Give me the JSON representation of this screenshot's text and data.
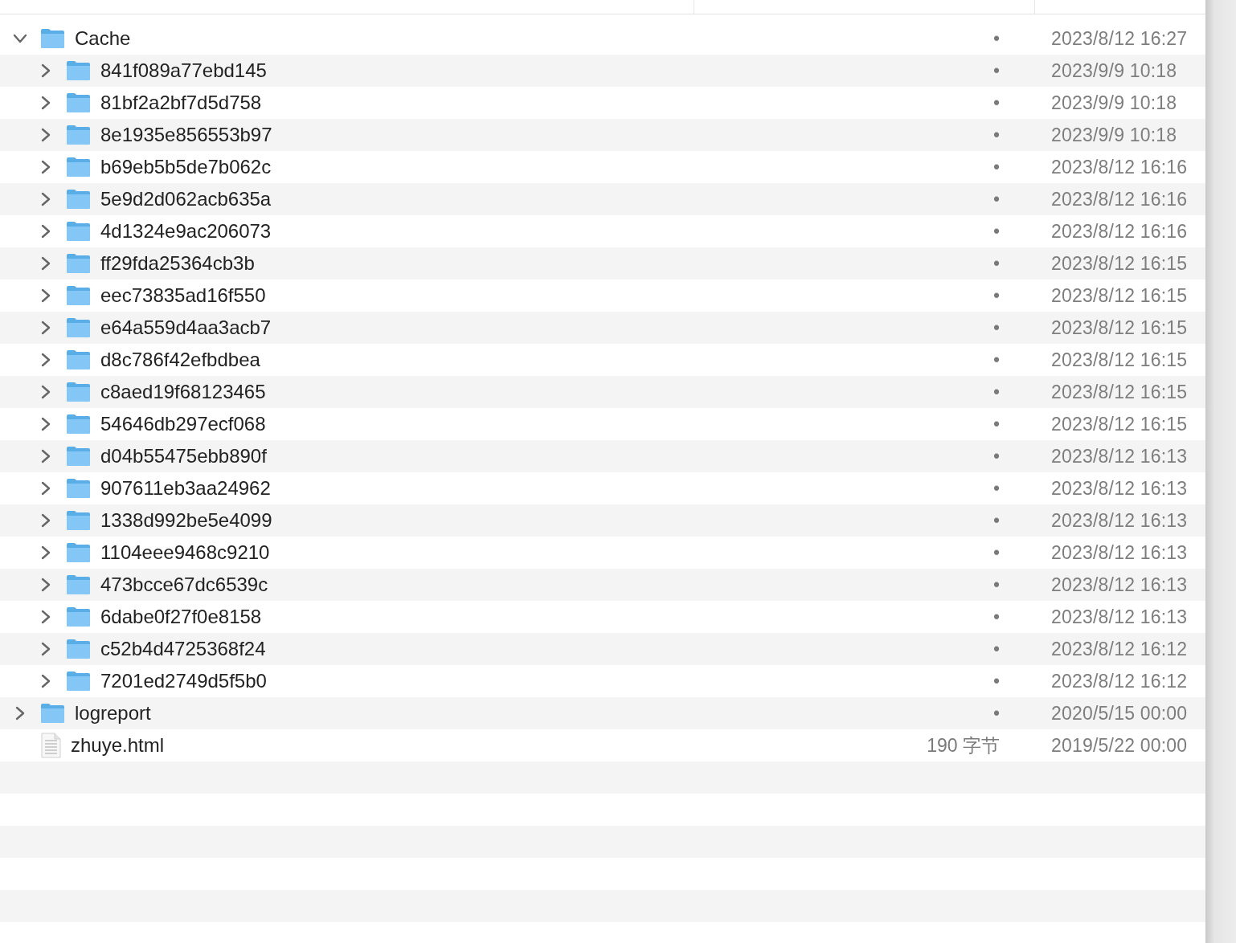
{
  "items": [
    {
      "kind": "folder",
      "name": "Cache",
      "size": "•",
      "date": "2023/8/12 16:27",
      "expanded": true,
      "children": [
        {
          "kind": "folder",
          "name": "841f089a77ebd145",
          "size": "•",
          "date": "2023/9/9 10:18",
          "expanded": false
        },
        {
          "kind": "folder",
          "name": "81bf2a2bf7d5d758",
          "size": "•",
          "date": "2023/9/9 10:18",
          "expanded": false
        },
        {
          "kind": "folder",
          "name": "8e1935e856553b97",
          "size": "•",
          "date": "2023/9/9 10:18",
          "expanded": false
        },
        {
          "kind": "folder",
          "name": "b69eb5b5de7b062c",
          "size": "•",
          "date": "2023/8/12 16:16",
          "expanded": false
        },
        {
          "kind": "folder",
          "name": "5e9d2d062acb635a",
          "size": "•",
          "date": "2023/8/12 16:16",
          "expanded": false
        },
        {
          "kind": "folder",
          "name": "4d1324e9ac206073",
          "size": "•",
          "date": "2023/8/12 16:16",
          "expanded": false
        },
        {
          "kind": "folder",
          "name": "ff29fda25364cb3b",
          "size": "•",
          "date": "2023/8/12 16:15",
          "expanded": false
        },
        {
          "kind": "folder",
          "name": "eec73835ad16f550",
          "size": "•",
          "date": "2023/8/12 16:15",
          "expanded": false
        },
        {
          "kind": "folder",
          "name": "e64a559d4aa3acb7",
          "size": "•",
          "date": "2023/8/12 16:15",
          "expanded": false
        },
        {
          "kind": "folder",
          "name": "d8c786f42efbdbea",
          "size": "•",
          "date": "2023/8/12 16:15",
          "expanded": false
        },
        {
          "kind": "folder",
          "name": "c8aed19f68123465",
          "size": "•",
          "date": "2023/8/12 16:15",
          "expanded": false
        },
        {
          "kind": "folder",
          "name": "54646db297ecf068",
          "size": "•",
          "date": "2023/8/12 16:15",
          "expanded": false
        },
        {
          "kind": "folder",
          "name": "d04b55475ebb890f",
          "size": "•",
          "date": "2023/8/12 16:13",
          "expanded": false
        },
        {
          "kind": "folder",
          "name": "907611eb3aa24962",
          "size": "•",
          "date": "2023/8/12 16:13",
          "expanded": false
        },
        {
          "kind": "folder",
          "name": "1338d992be5e4099",
          "size": "•",
          "date": "2023/8/12 16:13",
          "expanded": false
        },
        {
          "kind": "folder",
          "name": "1104eee9468c9210",
          "size": "•",
          "date": "2023/8/12 16:13",
          "expanded": false
        },
        {
          "kind": "folder",
          "name": "473bcce67dc6539c",
          "size": "•",
          "date": "2023/8/12 16:13",
          "expanded": false
        },
        {
          "kind": "folder",
          "name": "6dabe0f27f0e8158",
          "size": "•",
          "date": "2023/8/12 16:13",
          "expanded": false
        },
        {
          "kind": "folder",
          "name": "c52b4d4725368f24",
          "size": "•",
          "date": "2023/8/12 16:12",
          "expanded": false
        },
        {
          "kind": "folder",
          "name": "7201ed2749d5f5b0",
          "size": "•",
          "date": "2023/8/12 16:12",
          "expanded": false
        }
      ]
    },
    {
      "kind": "folder",
      "name": "logreport",
      "size": "•",
      "date": "2020/5/15 00:00",
      "expanded": false
    },
    {
      "kind": "file",
      "name": "zhuye.html",
      "size": "190 字节",
      "date": "2019/5/22 00:00"
    }
  ]
}
